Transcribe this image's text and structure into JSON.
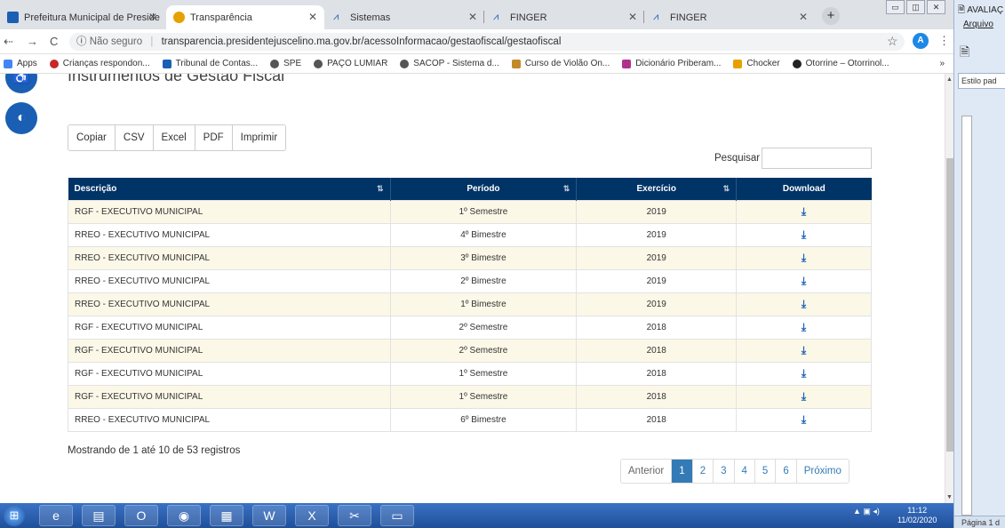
{
  "browser": {
    "tabs": [
      {
        "title": "Prefeitura Municipal de Preside",
        "icon": "municipal-icon",
        "color": "#1a5fb4"
      },
      {
        "title": "Transparência",
        "icon": "transparency-icon",
        "color": "#e6a100"
      },
      {
        "title": "Sistemas",
        "icon": "finger-icon",
        "color": "#1a5fb4"
      },
      {
        "title": "FINGER",
        "icon": "finger-icon",
        "color": "#1a5fb4"
      },
      {
        "title": "FINGER",
        "icon": "finger-icon",
        "color": "#1a5fb4"
      }
    ],
    "address": {
      "security": "Não seguro",
      "url": "transparencia.presidentejuscelino.ma.gov.br/acessoInformacao/gestaofiscal/gestaofiscal"
    },
    "profile_initial": "A",
    "bookmarks": [
      {
        "label": "Apps",
        "color": "#4285f4"
      },
      {
        "label": "Crianças respondon...",
        "color": "#c62828"
      },
      {
        "label": "Tribunal de Contas...",
        "color": "#1a5fb4"
      },
      {
        "label": "SPE",
        "color": "#555555"
      },
      {
        "label": "PAÇO LUMIAR",
        "color": "#555555"
      },
      {
        "label": "SACOP - Sistema d...",
        "color": "#555555"
      },
      {
        "label": "Curso de Violão On...",
        "color": "#c28a2a"
      },
      {
        "label": "Dicionário Priberam...",
        "color": "#b0328c"
      },
      {
        "label": "Chocker",
        "color": "#e6a100"
      },
      {
        "label": "Otorrine – Otorrinol...",
        "color": "#222222"
      }
    ],
    "bookmarks_more": "»"
  },
  "page": {
    "title": "Instrumentos de Gestão Fiscal",
    "export_buttons": [
      "Copiar",
      "CSV",
      "Excel",
      "PDF",
      "Imprimir"
    ],
    "search_label": "Pesquisar",
    "search_value": "",
    "table": {
      "headers": [
        "Descrição",
        "Período",
        "Exercício",
        "Download"
      ],
      "rows": [
        {
          "descricao": "RGF - EXECUTIVO MUNICIPAL",
          "periodo": "1º Semestre",
          "exercicio": "2019"
        },
        {
          "descricao": "RREO - EXECUTIVO MUNICIPAL",
          "periodo": "4º Bimestre",
          "exercicio": "2019"
        },
        {
          "descricao": "RREO - EXECUTIVO MUNICIPAL",
          "periodo": "3º Bimestre",
          "exercicio": "2019"
        },
        {
          "descricao": "RREO - EXECUTIVO MUNICIPAL",
          "periodo": "2º Bimestre",
          "exercicio": "2019"
        },
        {
          "descricao": "RREO - EXECUTIVO MUNICIPAL",
          "periodo": "1º Bimestre",
          "exercicio": "2019"
        },
        {
          "descricao": "RGF - EXECUTIVO MUNICIPAL",
          "periodo": "2º Semestre",
          "exercicio": "2018"
        },
        {
          "descricao": "RGF - EXECUTIVO MUNICIPAL",
          "periodo": "2º Semestre",
          "exercicio": "2018"
        },
        {
          "descricao": "RGF - EXECUTIVO MUNICIPAL",
          "periodo": "1º Semestre",
          "exercicio": "2018"
        },
        {
          "descricao": "RGF - EXECUTIVO MUNICIPAL",
          "periodo": "1º Semestre",
          "exercicio": "2018"
        },
        {
          "descricao": "RREO - EXECUTIVO MUNICIPAL",
          "periodo": "6º Bimestre",
          "exercicio": "2018"
        }
      ]
    },
    "info": "Mostrando de 1 até 10 de 53 registros",
    "pagination": {
      "prev": "Anterior",
      "pages": [
        "1",
        "2",
        "3",
        "4",
        "5",
        "6"
      ],
      "current": "1",
      "next": "Próximo"
    }
  },
  "word": {
    "title": "AVALIAÇ",
    "menu_file": "Arquivo",
    "style": "Estilo pad",
    "status": "Página 1 d"
  },
  "taskbar": {
    "time": "11:12",
    "date": "11/02/2020"
  },
  "colors": {
    "header": "#003366",
    "row_alt": "#fcf8e8",
    "link": "#337ab7"
  }
}
